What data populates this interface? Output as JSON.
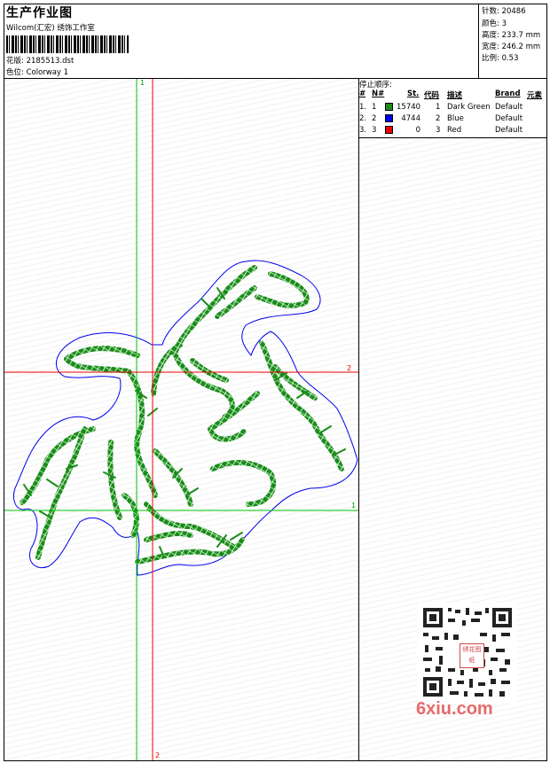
{
  "header": {
    "title": "生产作业图",
    "company": "Wilcom(汇宏) 绣饰工作室",
    "design_label": "花版:",
    "design_value": "2185513.dst",
    "colorway_label": "色位:",
    "colorway_value": "Colorway 1"
  },
  "stats": {
    "stitches": "针数: 20486",
    "colors": "颜色: 3",
    "height": "高度: 233.7 mm",
    "width": "宽度: 246.2 mm",
    "scale": "比例: 0.53"
  },
  "stop_sequence": {
    "title": "停止顺序:",
    "headers": [
      "#",
      "N#",
      "St.",
      "代码",
      "描述",
      "Brand",
      "元素"
    ],
    "rows": [
      {
        "num": "1.",
        "needle": "1",
        "color": "#1a8c1a",
        "stitches": "15740",
        "code": "1",
        "desc": "Dark Green",
        "brand": "Default"
      },
      {
        "num": "2.",
        "needle": "2",
        "color": "#0000ee",
        "stitches": "4744",
        "code": "2",
        "desc": "Blue",
        "brand": "Default"
      },
      {
        "num": "3.",
        "needle": "3",
        "color": "#ee0000",
        "stitches": "0",
        "code": "3",
        "desc": "Red",
        "brand": "Default"
      }
    ]
  },
  "axes": {
    "green_top": "1",
    "green_right": "1",
    "red_right": "2",
    "red_bottom": "2"
  },
  "watermark": {
    "text": "6xiu.com",
    "seal": "绣花图纸"
  },
  "colors": {
    "stitch_green": "#1a8c1a",
    "outline_blue": "#0000ee",
    "axis_red": "#ee0000",
    "axis_green": "#00c000"
  }
}
